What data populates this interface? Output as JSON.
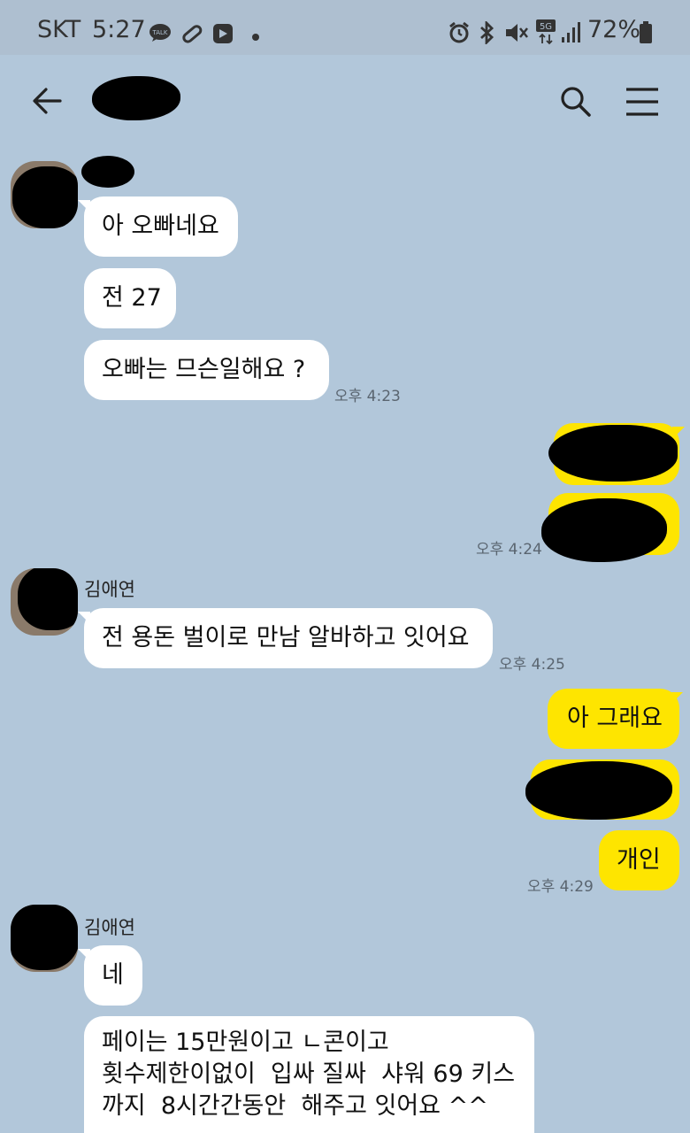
{
  "status_bar": {
    "carrier": "SKT",
    "time": "5:27",
    "battery": "72%",
    "icons": [
      "talk-icon",
      "pill-icon",
      "app-icon",
      "dot-icon",
      "alarm-icon",
      "bluetooth-icon",
      "mute-icon",
      "5g-icon",
      "signal-icon",
      "battery-icon"
    ]
  },
  "header": {
    "back_icon": "back-arrow-icon",
    "search_icon": "search-icon",
    "menu_icon": "menu-icon"
  },
  "messages": [
    {
      "side": "in",
      "text": "아 오빠네요"
    },
    {
      "side": "in",
      "text": "전 27"
    },
    {
      "side": "in",
      "text": "오빠는 므슨일해요 ?",
      "time": "오후 4:23"
    },
    {
      "side": "out",
      "time": "오후 4:24"
    },
    {
      "side": "in",
      "sender": "김애연",
      "text": "전 용돈 벌이로 만남 알바하고 잇어요",
      "time": "오후 4:25"
    },
    {
      "side": "out",
      "text": "아 그래요"
    },
    {
      "side": "out",
      "text": "개인",
      "time": "오후 4:29"
    },
    {
      "side": "in",
      "sender": "김애연",
      "text": "네"
    },
    {
      "side": "in",
      "lines": [
        "페이는 15만원이고 ㄴ콘이고",
        "횟수제한이없이  입싸 질싸  샤워 69 키스",
        "까지  8시간간동안  해주고 잇어요 ^^"
      ]
    }
  ]
}
